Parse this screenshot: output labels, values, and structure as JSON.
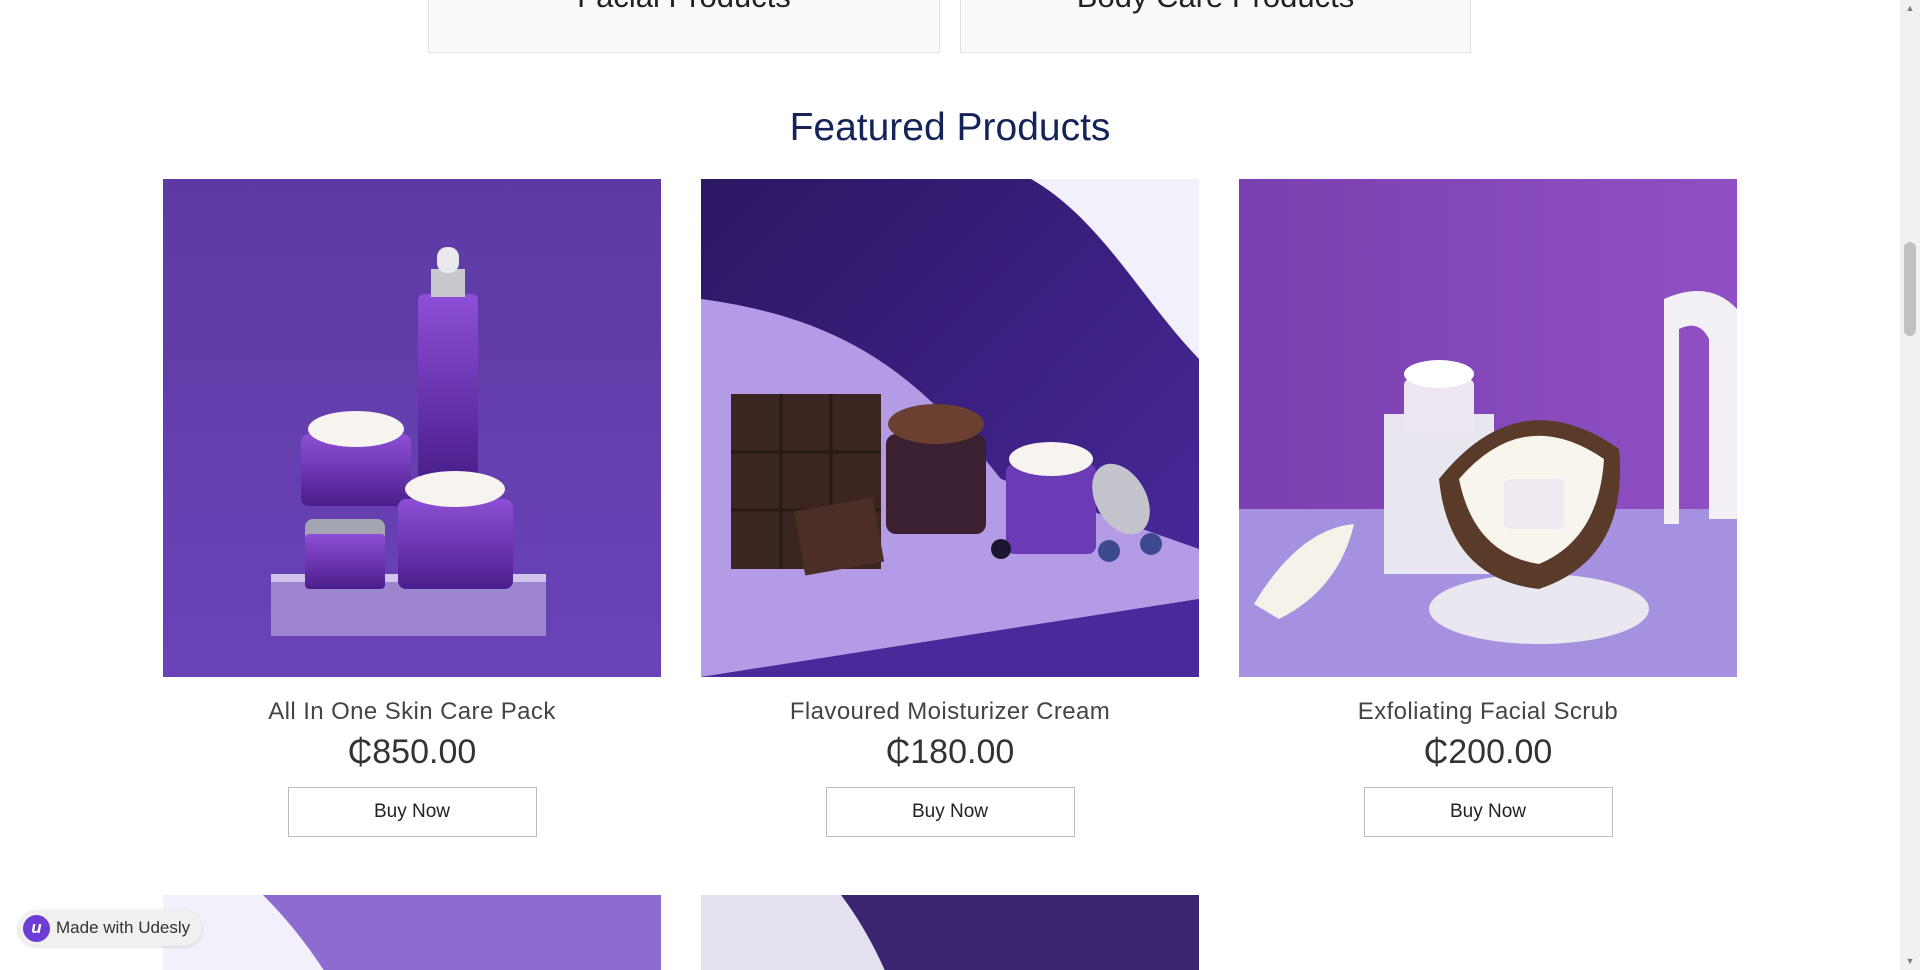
{
  "categories": [
    {
      "label": "Facial Products"
    },
    {
      "label": "Body Care Products"
    }
  ],
  "featured": {
    "title": "Featured Products",
    "products": [
      {
        "name": "All In One Skin Care Pack",
        "price": "₵850.00",
        "button": "Buy Now"
      },
      {
        "name": "Flavoured Moisturizer Cream",
        "price": "₵180.00",
        "button": "Buy Now"
      },
      {
        "name": "Exfoliating Facial Scrub",
        "price": "₵200.00",
        "button": "Buy Now"
      }
    ]
  },
  "badge": {
    "label": "Made with Udesly",
    "logo_letter": "u",
    "logo_color": "#6d3bd6"
  },
  "colors": {
    "title": "#14235a",
    "brand_purple": "#5a2ea6",
    "background": "#ffffff"
  },
  "icons": {
    "scroll_up": "triangle-up-icon",
    "scroll_down": "triangle-down-icon"
  }
}
